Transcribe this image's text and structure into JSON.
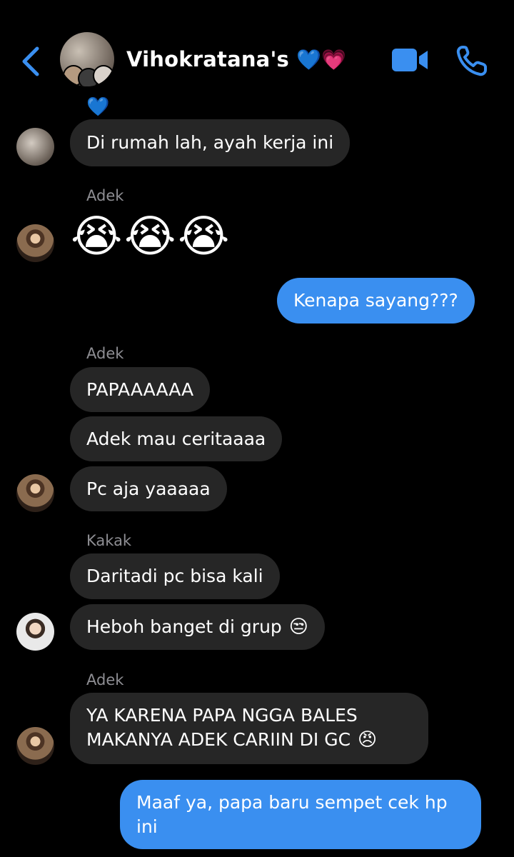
{
  "header": {
    "title": "Vihokratana's",
    "title_emoji": "💙💗",
    "back_icon": "chevron-left-icon",
    "video_icon": "video-camera-icon",
    "call_icon": "phone-icon",
    "accent_color": "#3a8ff0"
  },
  "reaction_above": "💙",
  "messages": {
    "m1": "Di rumah lah, ayah kerja ini",
    "adek_label_1": "Adek",
    "emoji_row": [
      "😭",
      "😭",
      "😭"
    ],
    "m2": "Kenapa sayang???",
    "adek_label_2": "Adek",
    "m3": "PAPAAAAAA",
    "m4": "Adek mau ceritaaaa",
    "m5": "Pc aja yaaaaa",
    "kakak_label": "Kakak",
    "m6": "Daritadi pc bisa kali",
    "m7": "Heboh banget di grup",
    "m7_emoji": "😒",
    "adek_label_3": "Adek",
    "m8": "YA KARENA PAPA NGGA BALES MAKANYA ADEK CARIIN DI GC",
    "m8_emoji": "😠",
    "m9": "Maaf ya, papa baru sempet cek hp ini"
  }
}
